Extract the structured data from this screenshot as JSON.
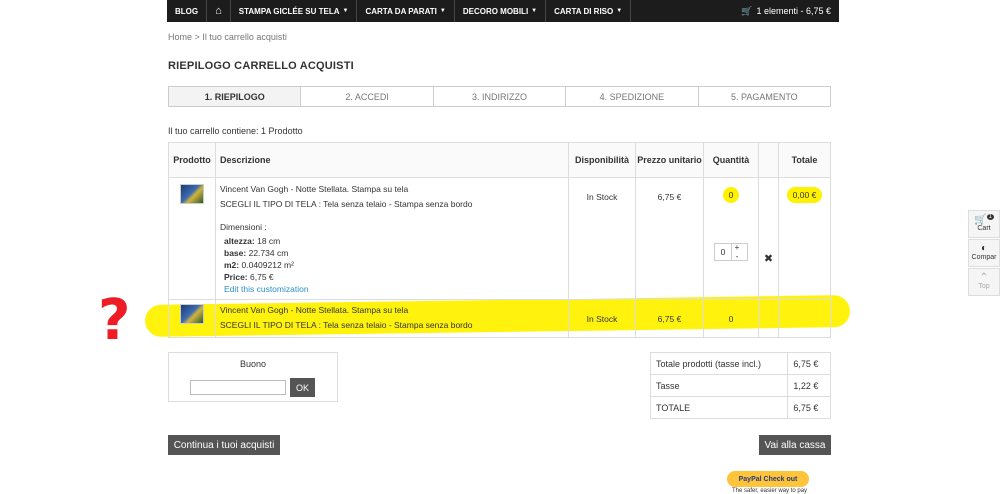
{
  "nav": {
    "blog": "BLOG",
    "home_icon": "home-icon",
    "stampa": "STAMPA GICLÉE SU TELA",
    "carta": "CARTA DA PARATI",
    "decoro": "DECORO MOBILI",
    "riso": "CARTA DI RISO",
    "cart": "1 elementi - 6,75 €"
  },
  "breadcrumb": {
    "home": "Home",
    "sep": ">",
    "current": "Il tuo carrello acquisti"
  },
  "title": "RIEPILOGO CARRELLO ACQUISTI",
  "steps": [
    "1. RIEPILOGO",
    "2. ACCEDI",
    "3. INDIRIZZO",
    "4. SPEDIZIONE",
    "5. PAGAMENTO"
  ],
  "count_text": "Il tuo carrello contiene: 1 Prodotto",
  "columns": {
    "prodotto": "Prodotto",
    "descrizione": "Descrizione",
    "disponibilita": "Disponibilità",
    "prezzo": "Prezzo unitario",
    "quantita": "Quantità",
    "totale": "Totale"
  },
  "row1": {
    "name": "Vincent Van Gogh - Notte Stellata. Stampa su tela",
    "option": "SCEGLI IL TIPO DI TELA : Tela senza telaio - Stampa senza bordo",
    "dims": "Dimensioni :",
    "altezza_l": "altezza:",
    "altezza_v": "18 cm",
    "base_l": "base:",
    "base_v": "22.734 cm",
    "m2_l": "m2:",
    "m2_v": "0.0409212 m²",
    "price_l": "Price:",
    "price_v": "6,75 €",
    "edit": "Edit this customization",
    "stock": "In Stock",
    "unit": "6,75 €",
    "qty": "0",
    "qty_input": "0",
    "plus": "+",
    "minus": "-",
    "delete": "✖",
    "total": "0,00 €"
  },
  "row2": {
    "name": "Vincent Van Gogh - Notte Stellata. Stampa su tela",
    "option": "SCEGLI IL TIPO DI TELA : Tela senza telaio - Stampa senza bordo",
    "stock": "In Stock",
    "unit": "6,75 €",
    "qty": "0"
  },
  "voucher": {
    "title": "Buono",
    "ok": "OK"
  },
  "totals": [
    {
      "l": "Totale prodotti (tasse incl.)",
      "v": "6,75 €"
    },
    {
      "l": "Tasse",
      "v": "1,22 €"
    },
    {
      "l": "TOTALE",
      "v": "6,75 €"
    }
  ],
  "continue": "Continua i tuoi acquisti",
  "checkout": "Vai alla cassa",
  "paypal": {
    "label": "PayPal Check out",
    "sub": "The safer, easier way to pay"
  },
  "side": {
    "cart": "Cart",
    "cart_count": "1",
    "compare": "Compar",
    "top": "Top"
  },
  "annotation": "?"
}
